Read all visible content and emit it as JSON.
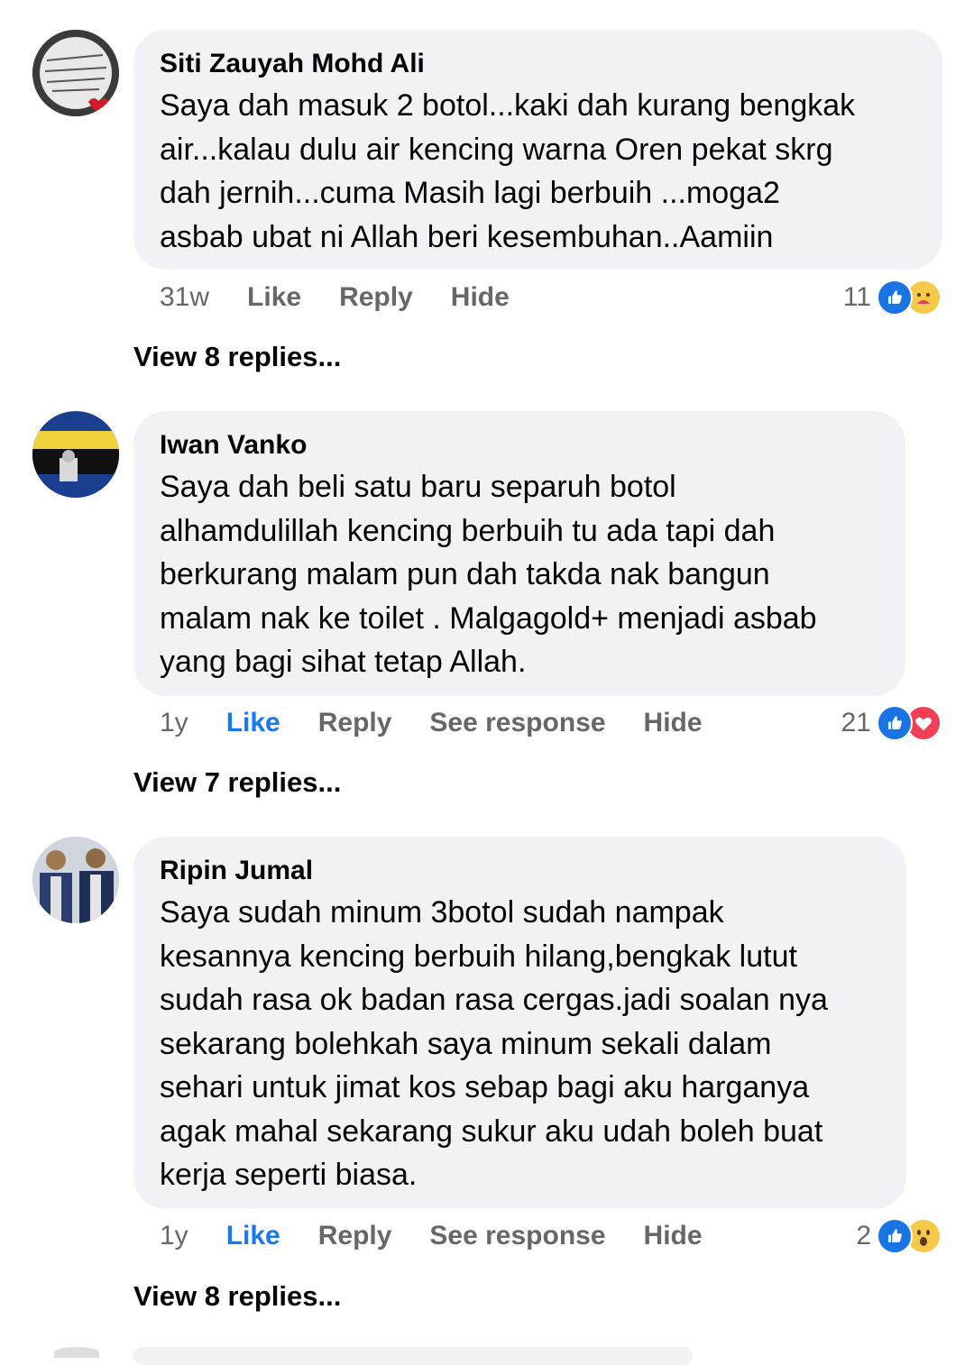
{
  "comments": [
    {
      "author": "Siti Zauyah Mohd Ali",
      "lines": [
        "Saya dah masuk 2 botol...kaki dah kurang bengkak",
        "air...kalau dulu  air kencing warna Oren pekat skrg",
        "dah jernih...cuma Masih lagi berbuih ...moga2",
        "asbab ubat ni Allah beri kesembuhan..Aamiin"
      ],
      "time": "31w",
      "like": "Like",
      "reply": "Reply",
      "hide": "Hide",
      "reaction_count": "11",
      "reactions": [
        "like-icon",
        "care-icon"
      ],
      "view_replies": "View 8 replies..."
    },
    {
      "author": "Iwan Vanko",
      "lines": [
        "Saya dah beli satu baru separuh botol",
        "alhamdulillah kencing berbuih tu ada tapi dah",
        "berkurang malam pun dah takda nak bangun",
        "malam nak ke toilet . Malgagold+ menjadi asbab",
        "yang bagi sihat tetap Allah."
      ],
      "time": "1y",
      "like": "Like",
      "reply": "Reply",
      "see_response": "See response",
      "hide": "Hide",
      "reaction_count": "21",
      "reactions": [
        "like-icon",
        "love-icon"
      ],
      "view_replies": "View 7 replies..."
    },
    {
      "author": "Ripin Jumal",
      "lines": [
        "Saya sudah minum 3botol sudah nampak",
        "kesannya kencing berbuih hilang,bengkak lutut",
        "sudah rasa ok badan rasa cergas.jadi soalan nya",
        "sekarang  bolehkah saya minum sekali dalam",
        "sehari untuk jimat kos sebap bagi aku harganya",
        "agak mahal sekarang sukur aku udah boleh buat",
        "kerja seperti biasa."
      ],
      "time": "1y",
      "like": "Like",
      "reply": "Reply",
      "see_response": "See response",
      "hide": "Hide",
      "reaction_count": "2",
      "reactions": [
        "like-icon",
        "wow-icon"
      ],
      "view_replies": "View 8 replies..."
    }
  ],
  "colors": {
    "bubble": "#f0f2f5",
    "text": "#050505",
    "meta": "#65676b",
    "liked": "#1877f2"
  }
}
